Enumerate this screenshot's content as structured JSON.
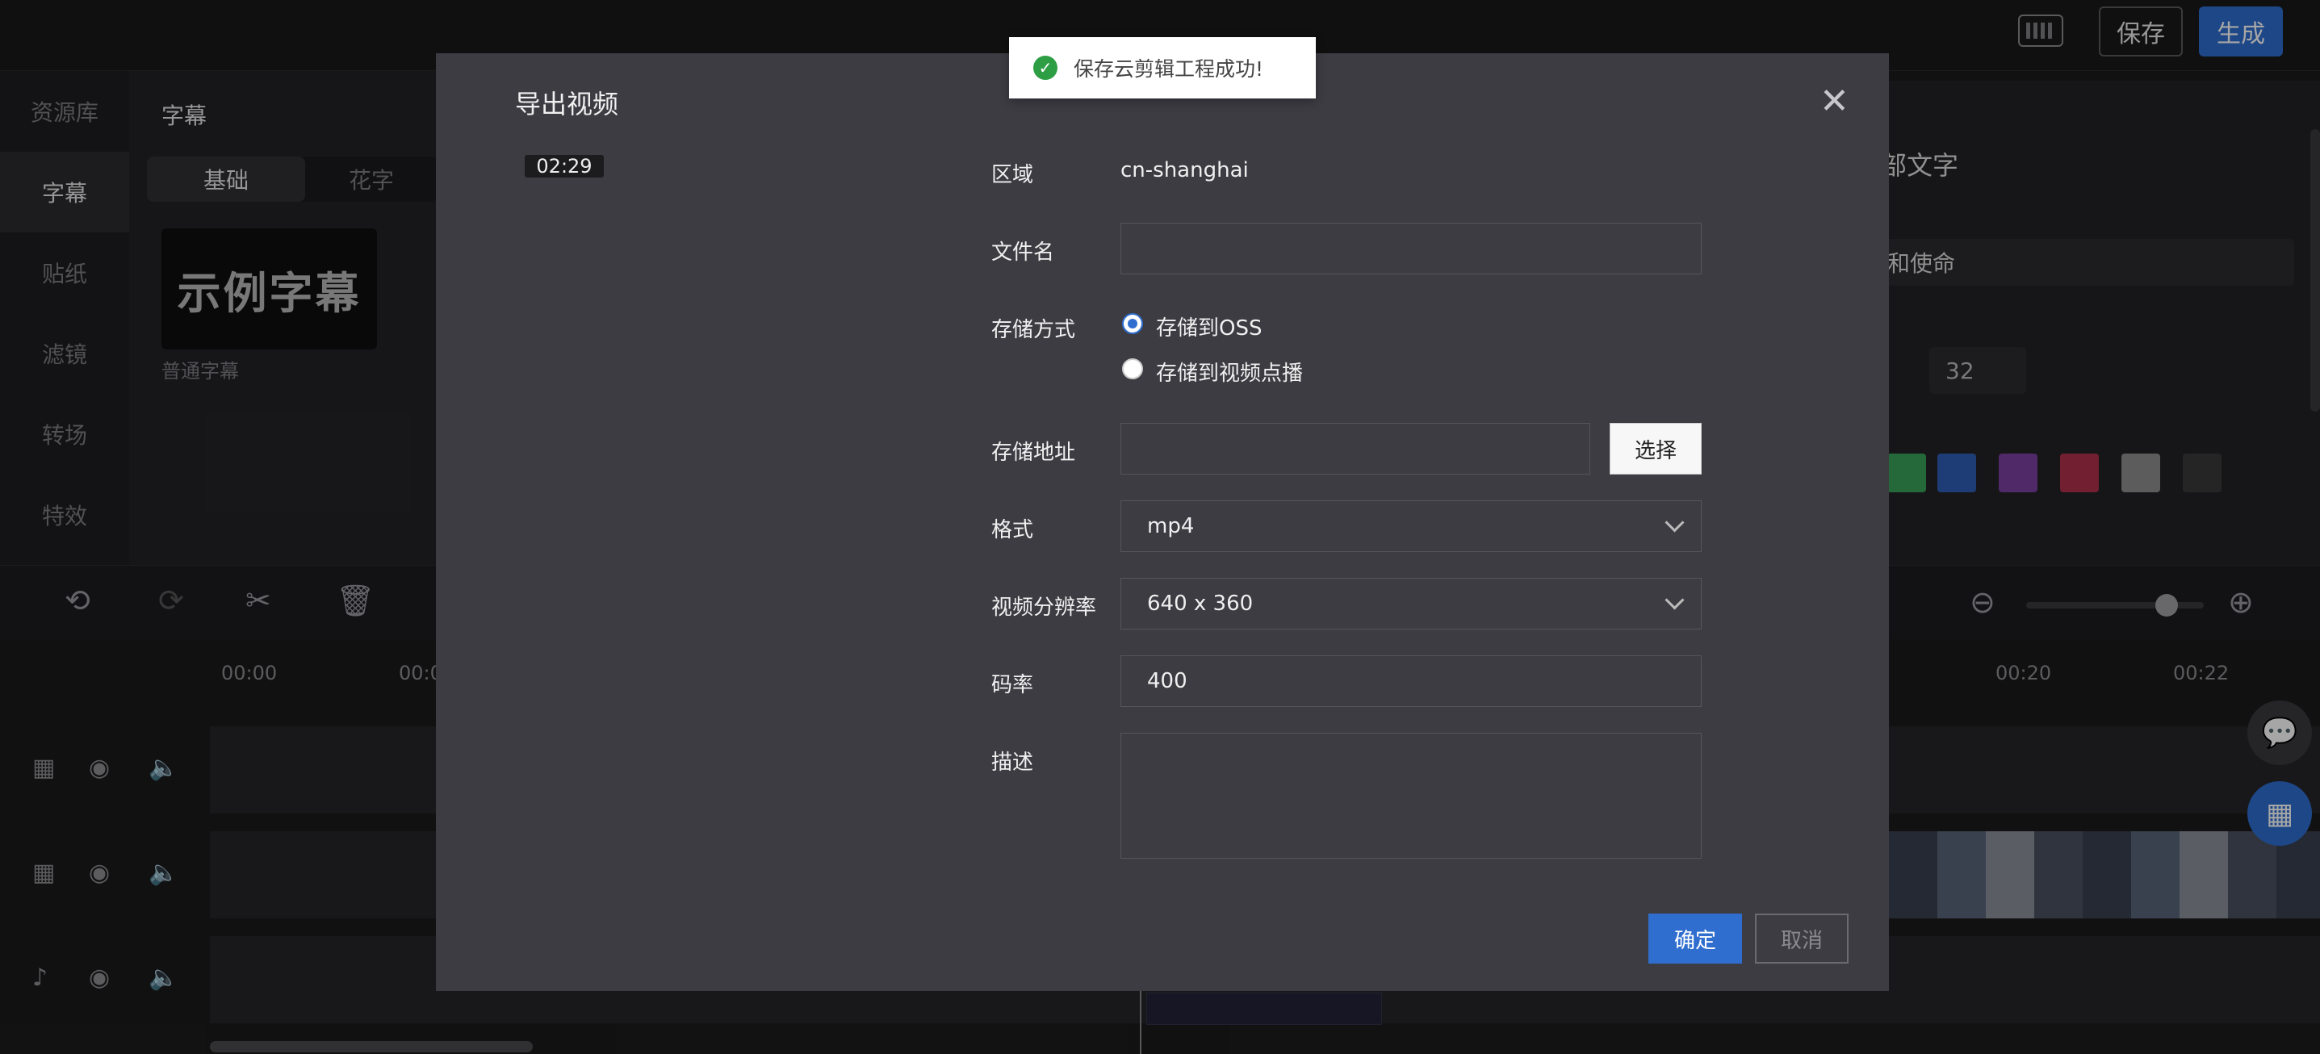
{
  "topbar": {
    "keyboard_icon": "keyboard-icon",
    "save_label": "保存",
    "generate_label": "生成",
    "accent_color": "#2f6ecf"
  },
  "sidebar": {
    "items": [
      {
        "label": "资源库"
      },
      {
        "label": "字幕"
      },
      {
        "label": "贴纸"
      },
      {
        "label": "滤镜"
      },
      {
        "label": "转场"
      },
      {
        "label": "特效"
      }
    ],
    "active_index": 1
  },
  "library": {
    "title": "字幕",
    "tabs": [
      "基础",
      "花字"
    ],
    "sample_text": "示例字幕",
    "sample_label": "普通字幕"
  },
  "props": {
    "title_partial": "部文字",
    "text_value": "和使命",
    "font_size": "32",
    "swatches": [
      "#3aa05a",
      "#2f5fb5",
      "#7a3fa0",
      "#b0304e",
      "#8e8e8e",
      "#3a3a3a"
    ]
  },
  "timeline": {
    "ticks": [
      "00:00",
      "00:0",
      "00:20",
      "00:22"
    ]
  },
  "toast": {
    "text": "保存云剪辑工程成功!",
    "icon": "check-circle-icon",
    "color": "#2e9e45"
  },
  "modal": {
    "title": "导出视频",
    "duration": "02:29",
    "region_label": "区域",
    "region_value": "cn-shanghai",
    "filename_label": "文件名",
    "filename_value": "",
    "storage_label": "存储方式",
    "storage_options": [
      "存储到OSS",
      "存储到视频点播"
    ],
    "storage_selected": 0,
    "address_label": "存储地址",
    "address_value": "",
    "select_label": "选择",
    "format_label": "格式",
    "format_value": "mp4",
    "resolution_label": "视频分辨率",
    "resolution_value": "640 x 360",
    "bitrate_label": "码率",
    "bitrate_value": "400",
    "description_label": "描述",
    "description_value": "",
    "ok_label": "确定",
    "cancel_label": "取消"
  }
}
